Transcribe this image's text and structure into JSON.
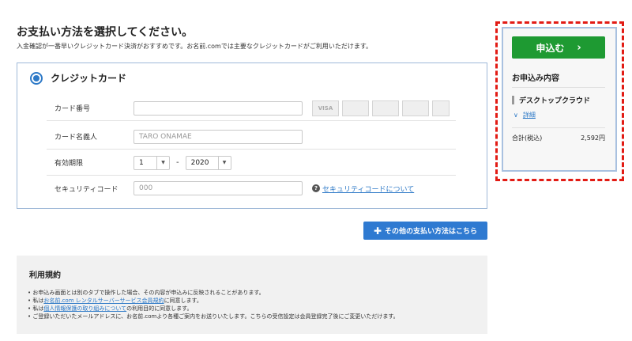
{
  "header": {
    "title": "お支払い方法を選択してください。",
    "subtitle": "入金確認が一番早いクレジットカード決済がおすすめです。お名前.comでは主要なクレジットカードがご利用いただけます。"
  },
  "card_section": {
    "option_label": "クレジットカード",
    "selected": true,
    "card_number": {
      "label": "カード番号",
      "value": "",
      "placeholder": ""
    },
    "brands": [
      "VISA",
      "MasterCard",
      "JCB",
      "Diners",
      "AMEX"
    ],
    "cardholder": {
      "label": "カード名義人",
      "placeholder": "TARO ONAMAE"
    },
    "expiry": {
      "label": "有効期限",
      "month": "1",
      "year": "2020"
    },
    "security_code": {
      "label": "セキュリティコード",
      "placeholder": "000",
      "help_link": "セキュリティコードについて"
    }
  },
  "other_payment_button": "その他の支払い方法はこちら",
  "terms": {
    "title": "利用規約",
    "items": [
      {
        "pre": "お申込み画面とは別のタブで操作した場合、その内容が申込みに反映されることがあります。",
        "link": "",
        "post": ""
      },
      {
        "pre": "私は",
        "link": "お名前.com レンタルサーバーサービス会員規約",
        "post": "に同意します。"
      },
      {
        "pre": "私は",
        "link": "個人情報保護の取り組みについて",
        "post": "の利用目的に同意します。"
      },
      {
        "pre": "ご登録いただいたメールアドレスに、お名前.comより各種ご案内をお送りいたします。こちらの受信設定は会員登録完了後にご変更いただけます。",
        "link": "",
        "post": ""
      }
    ]
  },
  "summary": {
    "apply_button": "申込む",
    "heading": "お申込み内容",
    "product": "デスクトップクラウド",
    "details_link": "詳細",
    "total_label": "合計(税込)",
    "total_value": "2,592円"
  },
  "colors": {
    "accent_blue": "#2d79c7",
    "apply_green": "#1e9a32",
    "highlight_red": "#e21b14"
  }
}
